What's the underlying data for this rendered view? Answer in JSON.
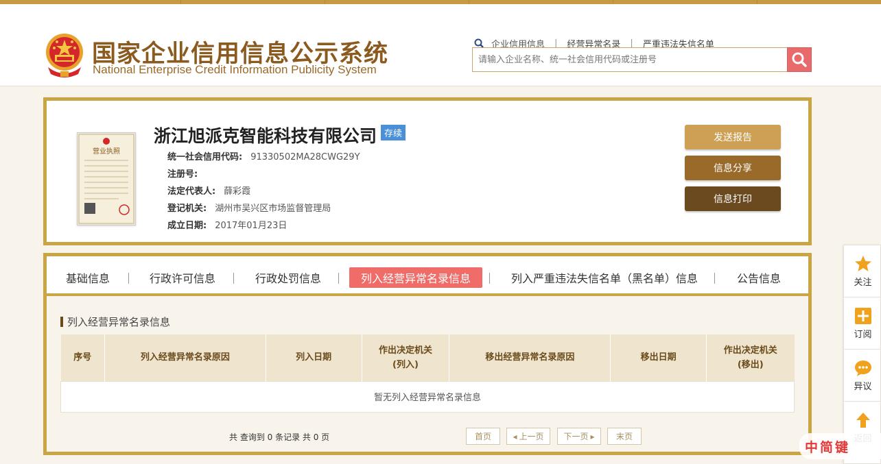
{
  "header": {
    "title_cn": "国家企业信用信息公示系统",
    "title_en": "National Enterprise Credit Information Publicity System",
    "search_links": [
      "企业信用信息",
      "经营异常名录",
      "严重违法失信名单"
    ],
    "search_placeholder": "请输入企业名称、统一社会信用代码或注册号"
  },
  "company": {
    "name": "浙江旭派克智能科技有限公司",
    "status": "存续",
    "fields": [
      {
        "label": "统一社会信用代码:",
        "value": "91330502MA28CWG29Y"
      },
      {
        "label": "注册号:",
        "value": ""
      },
      {
        "label": "法定代表人:",
        "value": "薛彩霞"
      },
      {
        "label": "登记机关:",
        "value": "湖州市吴兴区市场监督管理局"
      },
      {
        "label": "成立日期:",
        "value": "2017年01月23日"
      }
    ],
    "license_label": "营业执照"
  },
  "actions": [
    {
      "label": "发送报告",
      "color": "#cda056"
    },
    {
      "label": "信息分享",
      "color": "#9a6a2a"
    },
    {
      "label": "信息打印",
      "color": "#6a4a1e"
    }
  ],
  "tabs": [
    "基础信息",
    "行政许可信息",
    "行政处罚信息",
    "列入经营异常名录信息",
    "列入严重违法失信名单（黑名单）信息",
    "公告信息"
  ],
  "active_tab": 3,
  "section": {
    "title": "列入经营异常名录信息",
    "columns": [
      [
        "序号"
      ],
      [
        "列入经营异常名录原因"
      ],
      [
        "列入日期"
      ],
      [
        "作出决定机关",
        "(列入)"
      ],
      [
        "移出经营异常名录原因"
      ],
      [
        "移出日期"
      ],
      [
        "作出决定机关",
        "(移出)"
      ]
    ],
    "empty_text": "暂无列入经营异常名录信息"
  },
  "pager": {
    "summary": "共 查询到 0 条记录 共 0 页",
    "first": "首页",
    "prev": "上一页",
    "next": "下一页",
    "last": "末页"
  },
  "side_float": [
    "关注",
    "订阅",
    "异议",
    "返回"
  ],
  "watermark": "中简键"
}
